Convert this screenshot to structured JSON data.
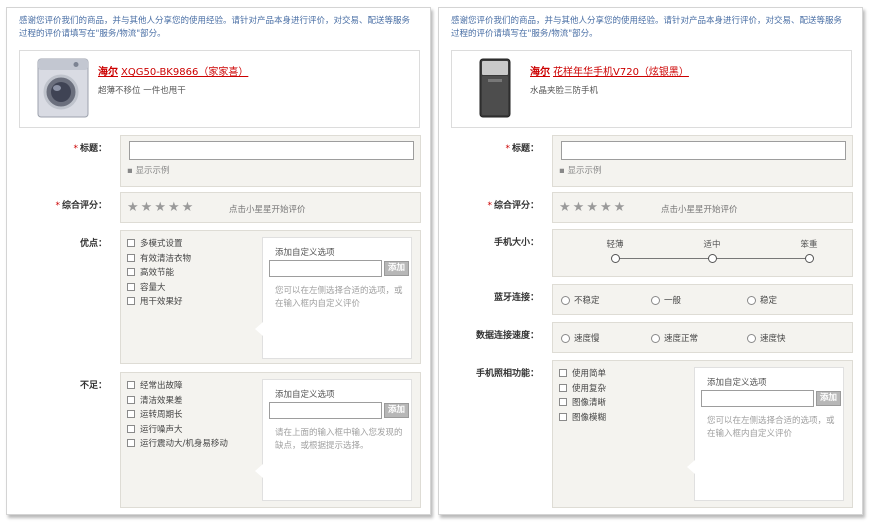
{
  "colors": {
    "accent": "#cc0000",
    "intro_text": "#4a6fa5",
    "panel_border": "#d4d4d4",
    "box_bg": "#f4f3ef"
  },
  "left": {
    "intro": "感谢您评价我们的商品，并与其他人分享您的使用经验。请针对产品本身进行评价，对交易、配送等服务过程的评价请填写在\"服务/物流\"部分。",
    "product": {
      "brand": "海尔",
      "model": "XQG50-BK9866（家家喜）",
      "desc": "超薄不移位 一件也甩干",
      "image_icon": "washing-machine-icon"
    },
    "title": {
      "label": "标题：",
      "required": "*",
      "value": "",
      "example": "显示示例"
    },
    "rating": {
      "label": "综合评分：",
      "required": "*",
      "stars": [
        "★",
        "★",
        "★",
        "★",
        "★"
      ],
      "hint": "点击小星星开始评价"
    },
    "pros": {
      "label": "优点：",
      "options": [
        "多模式设置",
        "有效清洁衣物",
        "高效节能",
        "容量大",
        "甩干效果好"
      ],
      "custom_title": "添加自定义选项",
      "add_label": "添加",
      "note": "您可以在左侧选择合适的选项，或在输入框内自定义评价"
    },
    "cons": {
      "label": "不足：",
      "options": [
        "经常出故障",
        "清洁效果差",
        "运转周期长",
        "运行噪声大",
        "运行震动大/机身易移动"
      ],
      "custom_title": "添加自定义选项",
      "add_label": "添加",
      "note": "请在上面的输入框中输入您发现的缺点，或根据提示选择。"
    }
  },
  "right": {
    "intro": "感谢您评价我们的商品，并与其他人分享您的使用经验。请针对产品本身进行评价，对交易、配送等服务过程的评价请填写在\"服务/物流\"部分。",
    "product": {
      "brand": "海尔",
      "model": "花样年华手机V720（炫银黑）",
      "desc": "水晶夹脸三防手机",
      "image_icon": "mobile-phone-icon"
    },
    "title": {
      "label": "标题：",
      "required": "*",
      "value": "",
      "example": "显示示例"
    },
    "rating": {
      "label": "综合评分：",
      "required": "*",
      "stars": [
        "★",
        "★",
        "★",
        "★",
        "★"
      ],
      "hint": "点击小星星开始评价"
    },
    "size": {
      "label": "手机大小：",
      "levels": [
        "轻薄",
        "适中",
        "笨重"
      ]
    },
    "bluetooth": {
      "label": "蓝牙连接：",
      "options": [
        "不稳定",
        "一般",
        "稳定"
      ]
    },
    "data_speed": {
      "label": "数据连接速度：",
      "options": [
        "速度慢",
        "速度正常",
        "速度快"
      ]
    },
    "camera": {
      "label": "手机照相功能：",
      "options": [
        "使用简单",
        "使用复杂",
        "图像清晰",
        "图像模糊"
      ],
      "custom_title": "添加自定义选项",
      "add_label": "添加",
      "note": "您可以在左侧选择合适的选项，或在输入框内自定义评价"
    }
  }
}
